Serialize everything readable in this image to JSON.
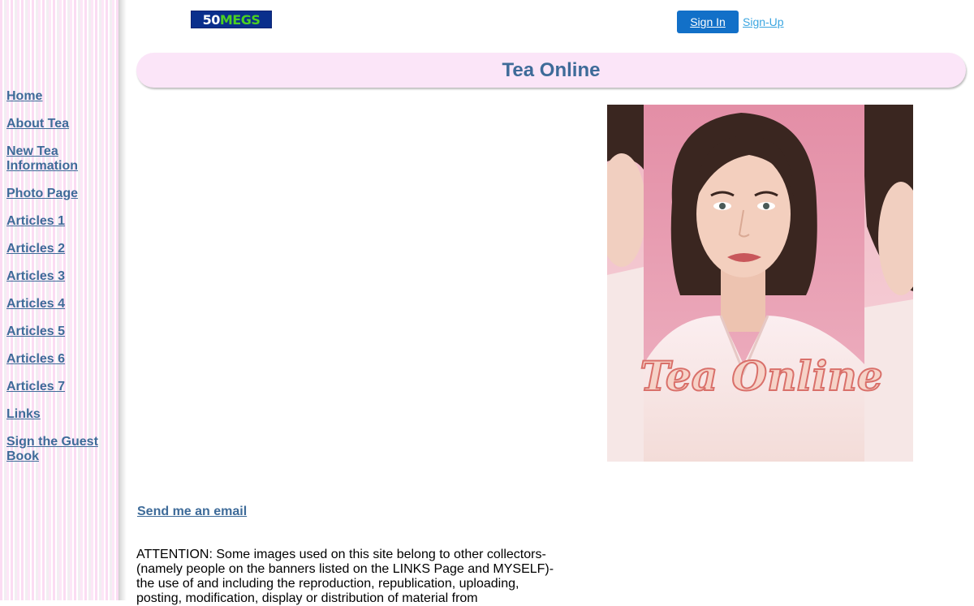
{
  "header": {
    "logo": {
      "number": "50",
      "text": "MEGS"
    },
    "sign_in": "Sign In",
    "sign_up": "Sign-Up"
  },
  "title": "Tea Online",
  "sidebar": {
    "items": [
      {
        "label": "Home "
      },
      {
        "label": "About Tea"
      },
      {
        "label": "New Tea Information"
      },
      {
        "label": "Photo Page"
      },
      {
        "label": "Articles 1"
      },
      {
        "label": "Articles 2"
      },
      {
        "label": "Articles 3"
      },
      {
        "label": "Articles 4"
      },
      {
        "label": "Articles 5"
      },
      {
        "label": "Articles 6"
      },
      {
        "label": "Articles 7"
      },
      {
        "label": "Links"
      },
      {
        "label": "Sign the Guest Book"
      }
    ]
  },
  "photo": {
    "overlay_text": "Tea Online"
  },
  "main": {
    "email_link": "Send me an email",
    "attention_text": "ATTENTION: Some images used on this site belong to other collectors- (namely people on the banners listed on the LINKS Page and MYSELF)- the use of and including the reproduction, republication, uploading, posting, modification, display or distribution of material from"
  },
  "colors": {
    "link": "#3e6b99",
    "title_bar": "#fbe5f8",
    "sign_in_bg": "#1270c8",
    "sign_up": "#3aa5e0",
    "sidebar_pink": "#fbdcf3"
  }
}
